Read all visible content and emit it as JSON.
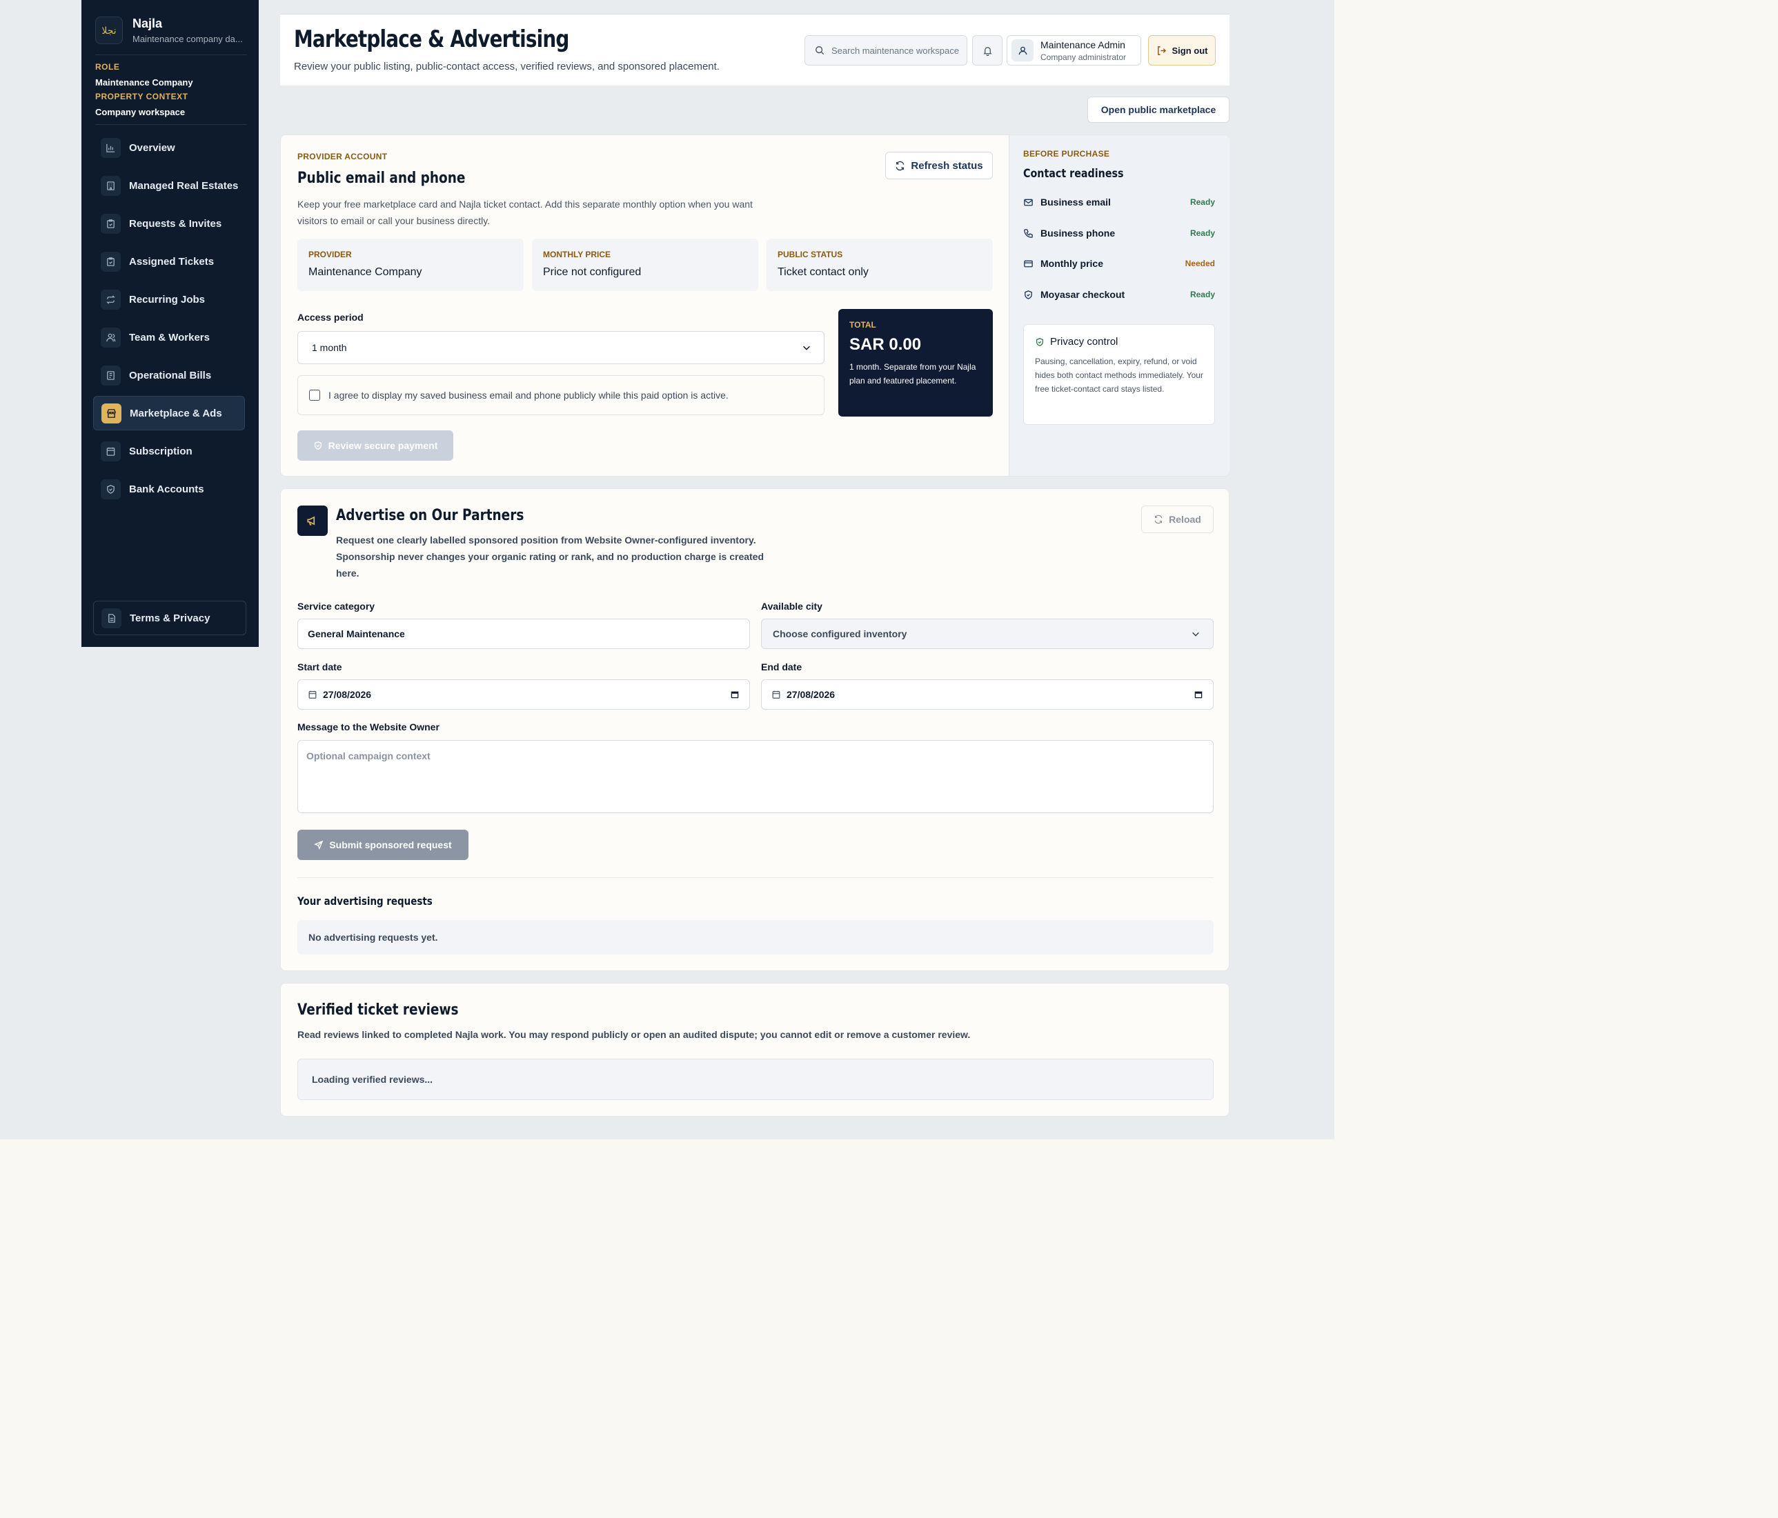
{
  "brand": {
    "name": "Najla",
    "subtitle": "Maintenance company da...",
    "logo_glyph": "نجلا"
  },
  "context": {
    "role_label": "ROLE",
    "role_value": "Maintenance Company",
    "property_label": "PROPERTY CONTEXT",
    "property_value": "Company workspace"
  },
  "nav": {
    "items": [
      {
        "label": "Overview",
        "icon": "chart-icon"
      },
      {
        "label": "Managed Real Estates",
        "icon": "building-icon"
      },
      {
        "label": "Requests & Invites",
        "icon": "clipboard-icon"
      },
      {
        "label": "Assigned Tickets",
        "icon": "clipboard-check-icon"
      },
      {
        "label": "Recurring Jobs",
        "icon": "repeat-icon"
      },
      {
        "label": "Team & Workers",
        "icon": "users-icon"
      },
      {
        "label": "Operational Bills",
        "icon": "receipt-icon"
      },
      {
        "label": "Marketplace & Ads",
        "icon": "store-icon",
        "active": true
      },
      {
        "label": "Subscription",
        "icon": "calendar-icon"
      },
      {
        "label": "Bank Accounts",
        "icon": "shield-icon"
      }
    ],
    "terms_label": "Terms & Privacy"
  },
  "header": {
    "title": "Marketplace & Advertising",
    "subtitle": "Review your public listing, public-contact access, verified reviews, and sponsored placement.",
    "search_placeholder": "Search maintenance workspace",
    "user_name": "Maintenance Admin",
    "user_role": "Company administrator",
    "signout_label": "Sign out"
  },
  "open_marketplace_label": "Open public marketplace",
  "provider": {
    "eyebrow": "PROVIDER ACCOUNT",
    "title": "Public email and phone",
    "description": "Keep your free marketplace card and Najla ticket contact. Add this separate monthly option when you want visitors to email or call your business directly.",
    "refresh_label": "Refresh status",
    "stats": [
      {
        "label": "PROVIDER",
        "value": "Maintenance Company"
      },
      {
        "label": "MONTHLY PRICE",
        "value": "Price not configured"
      },
      {
        "label": "PUBLIC STATUS",
        "value": "Ticket contact only"
      }
    ],
    "access_label": "Access period",
    "access_value": "1 month",
    "agree_text": "I agree to display my saved business email and phone publicly while this paid option is active.",
    "review_label": "Review secure payment",
    "total_label": "TOTAL",
    "total_value": "SAR 0.00",
    "total_note": "1 month. Separate from your Najla plan and featured placement."
  },
  "readiness": {
    "eyebrow": "BEFORE PURCHASE",
    "title": "Contact readiness",
    "items": [
      {
        "label": "Business email",
        "status": "Ready",
        "icon": "mail-icon",
        "color": "#2f7a4f"
      },
      {
        "label": "Business phone",
        "status": "Ready",
        "icon": "phone-icon",
        "color": "#2f7a4f"
      },
      {
        "label": "Monthly price",
        "status": "Needed",
        "icon": "card-icon",
        "color": "#a8631a"
      },
      {
        "label": "Moyasar checkout",
        "status": "Ready",
        "icon": "shield-icon",
        "color": "#2f7a4f"
      }
    ],
    "privacy_title": "Privacy control",
    "privacy_text": "Pausing, cancellation, expiry, refund, or void hides both contact methods immediately. Your free ticket-contact card stays listed."
  },
  "advertise": {
    "title": "Advertise on Our Partners",
    "description": "Request one clearly labelled sponsored position from Website Owner-configured inventory. Sponsorship never changes your organic rating or rank, and no production charge is created here.",
    "reload_label": "Reload",
    "category_label": "Service category",
    "category_value": "General Maintenance",
    "city_label": "Available city",
    "city_value": "Choose configured inventory",
    "start_label": "Start date",
    "start_value": "27/08/2026",
    "end_label": "End date",
    "end_value": "27/08/2026",
    "message_label": "Message to the Website Owner",
    "message_placeholder": "Optional campaign context",
    "submit_label": "Submit sponsored request",
    "requests_title": "Your advertising requests",
    "requests_empty": "No advertising requests yet."
  },
  "reviews": {
    "title": "Verified ticket reviews",
    "description": "Read reviews linked to completed Najla work. You may respond publicly or open an audited dispute; you cannot edit or remove a customer review.",
    "loading": "Loading verified reviews..."
  },
  "colors": {
    "sidebar": "#0d1b2c",
    "accent": "#e0b45a",
    "ready": "#2f7a4f",
    "needed": "#a8631a"
  }
}
